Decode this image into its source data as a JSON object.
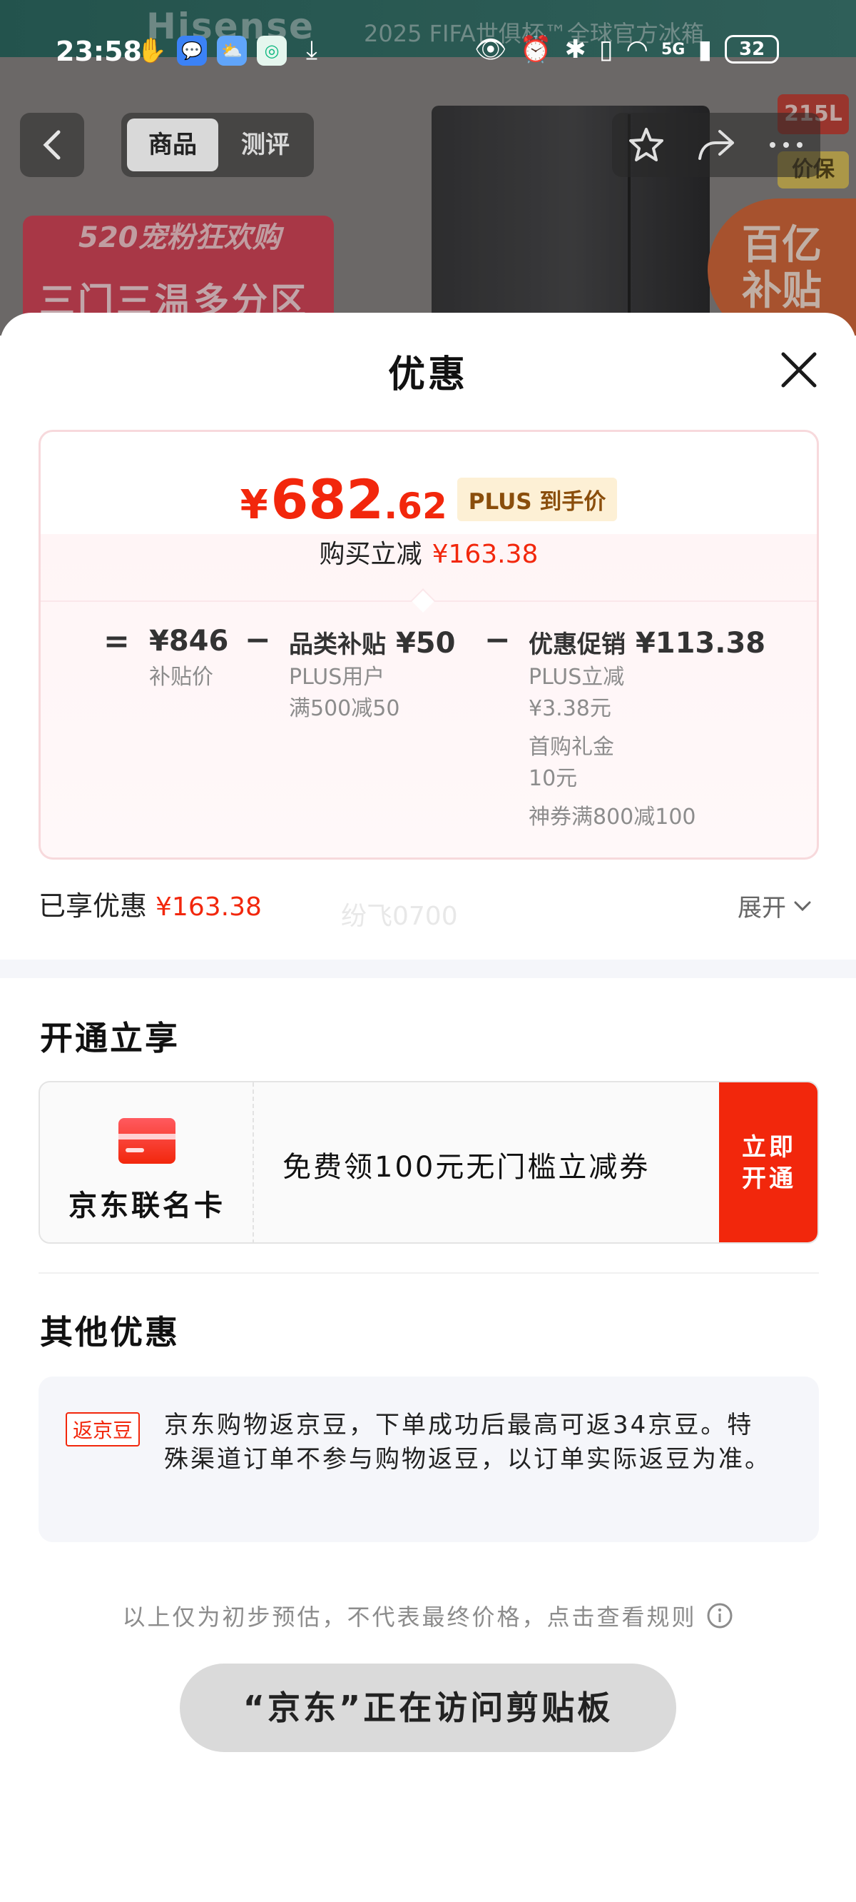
{
  "background": {
    "banner_brand": "Hisense",
    "banner_text": "2025 FIFA世俱杯™全球官方冰箱",
    "promo_card_top": "520宠粉狂欢购",
    "promo_card_main": "三门三温多分区",
    "subsidy_text": "百亿补贴",
    "tag_capacity": "215L",
    "tag_price_guarantee": "价保"
  },
  "status_bar": {
    "time": "23:58",
    "network": "5G",
    "battery": "32"
  },
  "nav": {
    "tabs": [
      "商品",
      "测评"
    ],
    "active_tab": "商品"
  },
  "sheet": {
    "title": "优惠",
    "price_card": {
      "currency": "¥",
      "price_int": "682",
      "price_dec": ".62",
      "plus_badge": "PLUS 到手价",
      "reduce_label": "购买立减",
      "reduce_amount": "¥163.38",
      "eq": "=",
      "minus": "−",
      "base_amount": "¥846",
      "base_label": "补贴价",
      "subsidy_label": "品类补贴",
      "subsidy_amount": "¥50",
      "subsidy_sub1": "PLUS用户",
      "subsidy_sub2": "满500减50",
      "promo_label": "优惠促销",
      "promo_amount": "¥113.38",
      "promo_sub1": "PLUS立减",
      "promo_sub2": "¥3.38元",
      "promo_sub3": "首购礼金",
      "promo_sub4": "10元",
      "promo_sub5": "神券满800减100"
    },
    "enjoyed_label": "已享优惠",
    "enjoyed_amount": "¥163.38",
    "watermark": "纷飞0700",
    "expand_label": "展开",
    "open_section": {
      "title": "开通立享",
      "card_name": "京东联名卡",
      "card_desc": "免费领100元无门槛立减券",
      "card_button": "立即开通"
    },
    "other_section": {
      "title": "其他优惠",
      "badge": "返京豆",
      "text": "京东购物返京豆，下单成功后最高可返34京豆。特殊渠道订单不参与购物返豆，以订单实际返豆为准。"
    },
    "disclaimer": "以上仅为初步预估，不代表最终价格，点击查看规则"
  },
  "toast": "“京东”正在访问剪贴板",
  "colors": {
    "accent_red": "#f2270c",
    "plus_gold": "#8a4e0c"
  }
}
